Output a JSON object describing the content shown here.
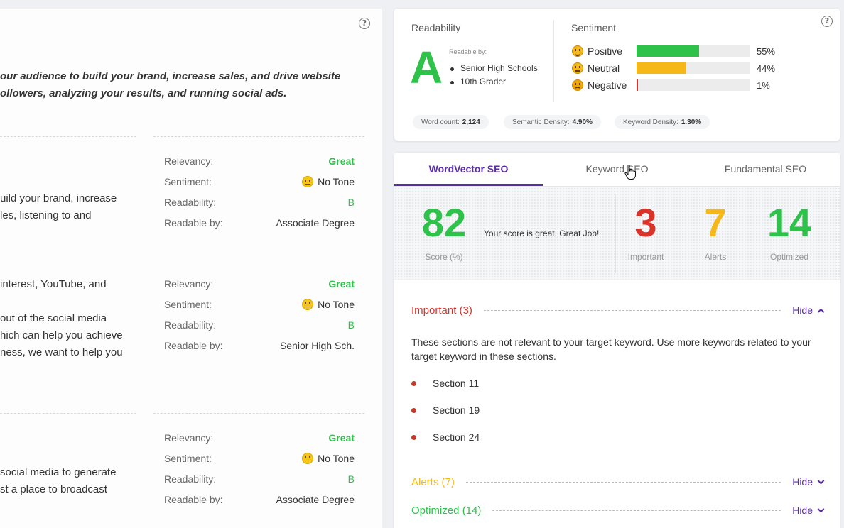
{
  "left": {
    "intro_lines": [
      "our audience to build your brand, increase sales, and drive website",
      "ollowers, analyzing your results, and running social ads."
    ],
    "labels": {
      "relevancy": "Relevancy:",
      "sentiment": "Sentiment:",
      "readability": "Readability:",
      "readable_by": "Readable by:"
    },
    "sections": [
      {
        "text_lines": [
          "uild your brand, increase",
          "les, listening to and"
        ],
        "relevancy": "Great",
        "sentiment": "No Tone",
        "readability": "B",
        "readable_by": "Associate Degree"
      },
      {
        "text_lines": [
          "interest, YouTube, and",
          "",
          "out of the social media",
          "hich can help you achieve",
          "ness, we want to help you"
        ],
        "relevancy": "Great",
        "sentiment": "No Tone",
        "readability": "B",
        "readable_by": "Senior High Sch."
      },
      {
        "text_lines": [
          "social media to generate",
          "st a place to broadcast"
        ],
        "relevancy": "Great",
        "sentiment": "No Tone",
        "readability": "B",
        "readable_by": "Associate Degree"
      }
    ]
  },
  "readability": {
    "title": "Readability",
    "grade": "A",
    "readable_by_label": "Readable by:",
    "levels": [
      "Senior High Schools",
      "10th Grader"
    ]
  },
  "sentiment": {
    "title": "Sentiment",
    "items": [
      {
        "label": "Positive",
        "pct": "55%",
        "value": 55,
        "color": "#2ec24b"
      },
      {
        "label": "Neutral",
        "pct": "44%",
        "value": 44,
        "color": "#f5b818"
      },
      {
        "label": "Negative",
        "pct": "1%",
        "value": 1,
        "color": "#d9342b"
      }
    ]
  },
  "stats": {
    "word_count_label": "Word count:",
    "word_count": "2,124",
    "semantic_label": "Semantic Density:",
    "semantic": "4.90%",
    "keyword_label": "Keyword Density:",
    "keyword": "1.30%"
  },
  "tabs": [
    "WordVector SEO",
    "Keyword SEO",
    "Fundamental SEO"
  ],
  "score": {
    "value": "82",
    "label": "Score (%)",
    "message": "Your score is great. Great Job!",
    "important": "3",
    "important_label": "Important",
    "alerts": "7",
    "alerts_label": "Alerts",
    "optimized": "14",
    "optimized_label": "Optimized"
  },
  "colors": {
    "green": "#2ec24b",
    "red": "#d9342b",
    "amber": "#f5b818",
    "purple": "#5b2da8"
  },
  "important": {
    "title": "Important (3)",
    "toggle": "Hide",
    "description": "These sections are not relevant to your target keyword. Use more keywords related to your target keyword in these sections.",
    "sections": [
      "Section 11",
      "Section 19",
      "Section 24"
    ]
  },
  "alerts": {
    "title": "Alerts (7)",
    "toggle": "Hide"
  },
  "optimized": {
    "title": "Optimized (14)",
    "toggle": "Hide"
  }
}
